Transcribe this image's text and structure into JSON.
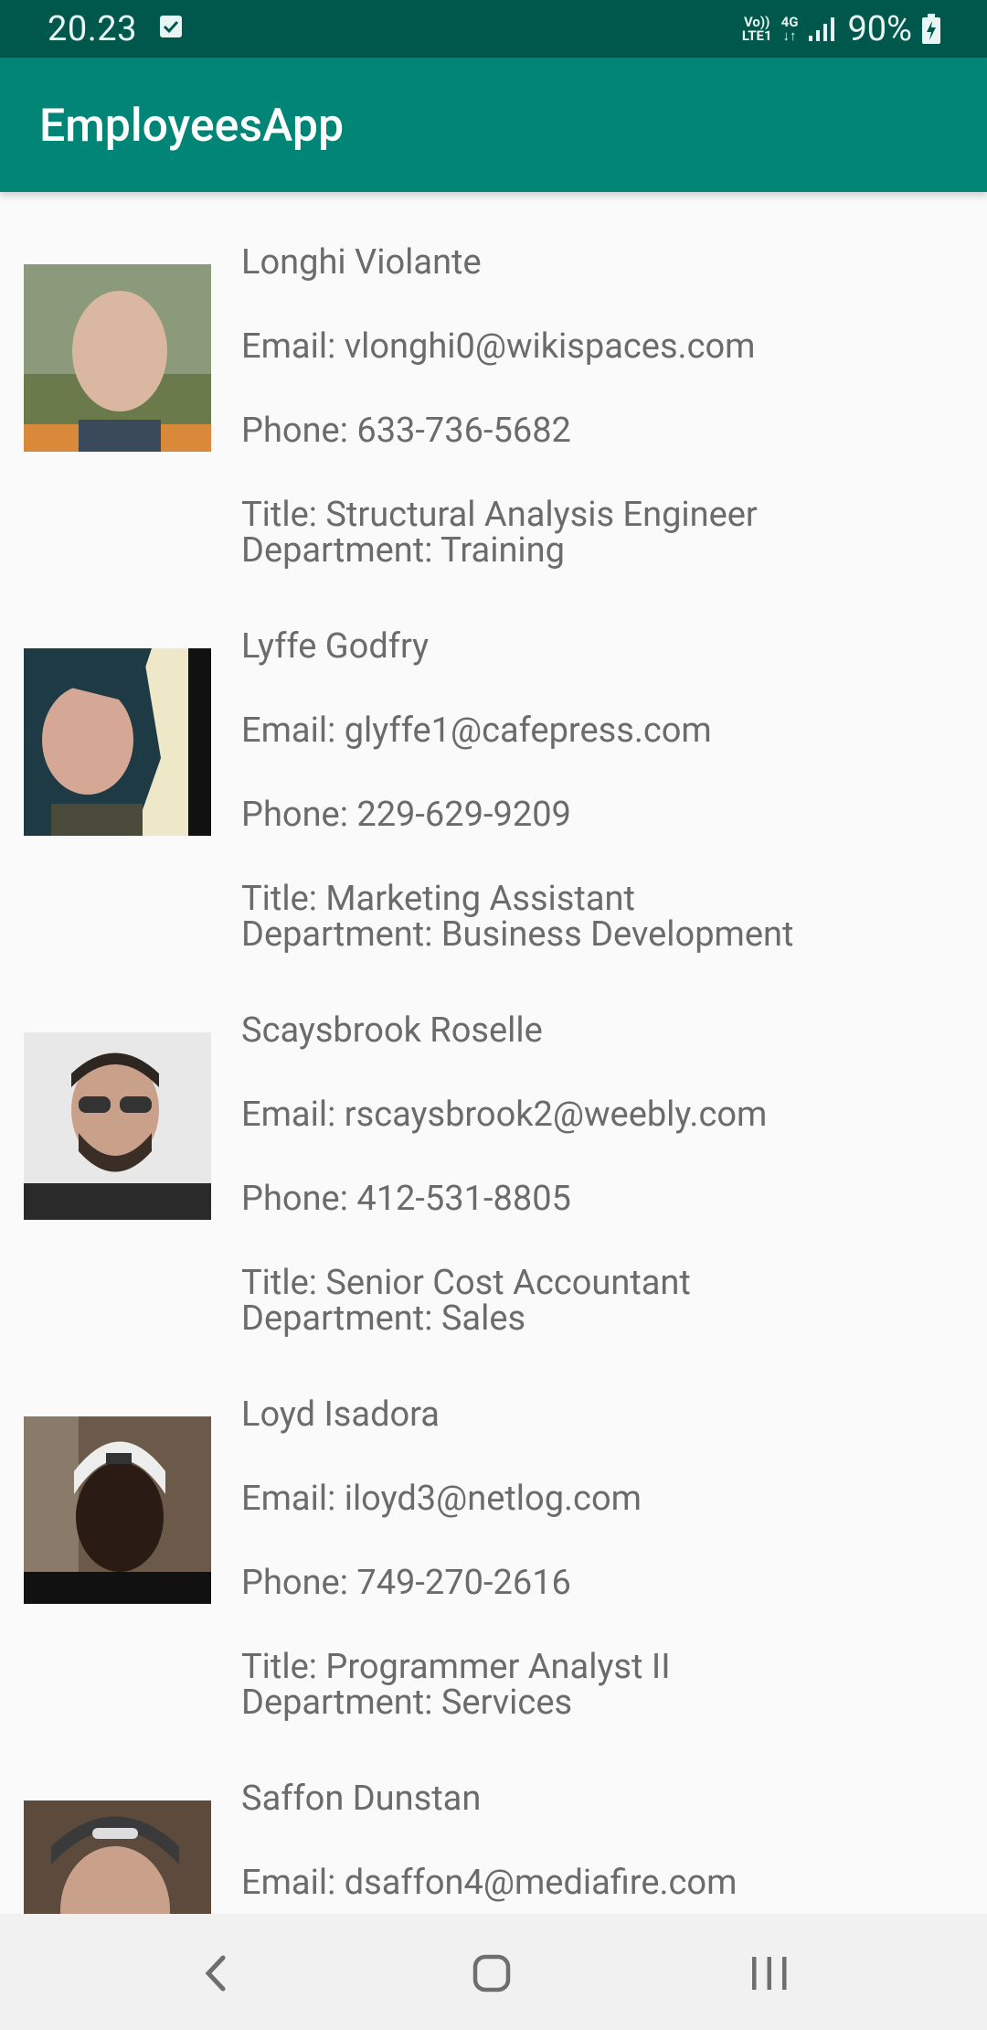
{
  "status": {
    "time": "20.23",
    "battery": "90%",
    "volte_top": "Vo))",
    "volte_bottom": "LTE1",
    "network": "4G"
  },
  "appbar": {
    "title": "EmployeesApp"
  },
  "employees": [
    {
      "name": "Longhi Violante",
      "email": "Email: vlonghi0@wikispaces.com",
      "phone": "Phone: 633-736-5682",
      "title": "Title: Structural Analysis Engineer",
      "department": "Department: Training",
      "avatar_colors": [
        "#6a7a4a",
        "#d9b7a0"
      ]
    },
    {
      "name": "Lyffe Godfry",
      "email": "Email: glyffe1@cafepress.com",
      "phone": "Phone: 229-629-9209",
      "title": "Title: Marketing Assistant",
      "department": "Department: Business Development",
      "avatar_colors": [
        "#1d3a45",
        "#efe8c8"
      ]
    },
    {
      "name": "Scaysbrook Roselle",
      "email": "Email: rscaysbrook2@weebly.com",
      "phone": "Phone: 412-531-8805",
      "title": "Title: Senior Cost Accountant",
      "department": "Department: Sales",
      "avatar_colors": [
        "#e8e8e8",
        "#3a3a3a"
      ]
    },
    {
      "name": "Loyd Isadora",
      "email": "Email: iloyd3@netlog.com",
      "phone": "Phone: 749-270-2616",
      "title": "Title: Programmer Analyst II",
      "department": "Department: Services",
      "avatar_colors": [
        "#6b5a4a",
        "#2a1c14"
      ]
    },
    {
      "name": "Saffon Dunstan",
      "email": "Email: dsaffon4@mediafire.com",
      "phone": "",
      "title": "",
      "department": "",
      "avatar_colors": [
        "#5c4a3c",
        "#c9a08a"
      ]
    }
  ],
  "colors": {
    "statusbar": "#00574b",
    "appbar": "#008577",
    "text": "#6b6b6b"
  }
}
